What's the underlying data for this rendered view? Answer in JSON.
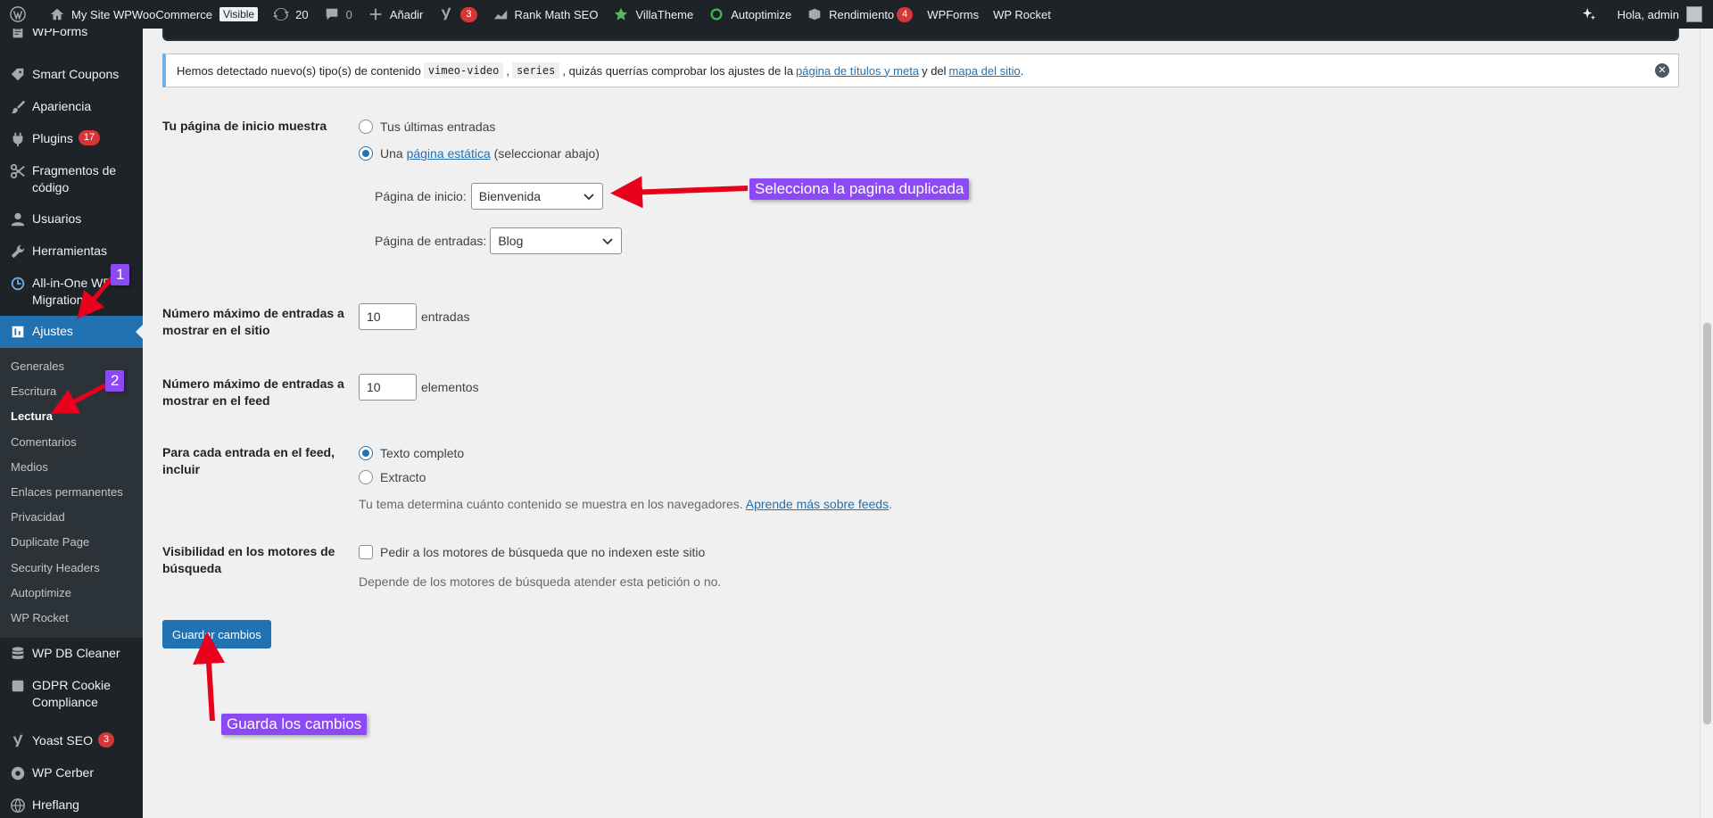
{
  "adminbar": {
    "site_name": "My Site WPWooCommerce",
    "visible_badge": "Visible",
    "updates_count": "20",
    "comments_count": "0",
    "add_new": "Añadir",
    "yoast_count": "3",
    "rank_math": "Rank Math SEO",
    "villatheme": "VillaTheme",
    "autoptimize": "Autoptimize",
    "rendimiento": "Rendimiento",
    "rendimiento_count": "4",
    "wpforms": "WPForms",
    "wprocket": "WP Rocket",
    "greeting": "Hola, admin"
  },
  "sidebar": {
    "items": [
      {
        "label": "WPForms",
        "icon": "wpforms-icon"
      },
      {
        "label": "Smart Coupons",
        "icon": "coupon-icon"
      },
      {
        "label": "Apariencia",
        "icon": "brush-icon"
      },
      {
        "label": "Plugins",
        "icon": "plugin-icon",
        "count": "17"
      },
      {
        "label": "Fragmentos de código",
        "icon": "scissors-icon"
      },
      {
        "label": "Usuarios",
        "icon": "user-icon"
      },
      {
        "label": "Herramientas",
        "icon": "wrench-icon"
      },
      {
        "label": "All-in-One WP Migration",
        "icon": "migration-icon"
      },
      {
        "label": "Ajustes",
        "icon": "settings-icon"
      }
    ],
    "submenu": [
      "Generales",
      "Escritura",
      "Lectura",
      "Comentarios",
      "Medios",
      "Enlaces permanentes",
      "Privacidad",
      "Duplicate Page",
      "Security Headers",
      "Autoptimize",
      "WP Rocket"
    ],
    "items_after": [
      {
        "label": "WP DB Cleaner",
        "icon": "database-icon"
      },
      {
        "label": "GDPR Cookie Compliance",
        "icon": "cookie-icon"
      },
      {
        "label": "Yoast SEO",
        "icon": "yoast-icon",
        "count": "3"
      },
      {
        "label": "WP Cerber",
        "icon": "shield-icon"
      },
      {
        "label": "Hreflang",
        "icon": "globe-icon"
      }
    ]
  },
  "notice": {
    "text_1": "Hemos detectado nuevo(s) tipo(s) de contenido",
    "code_1": "vimeo-video",
    "sep": ",",
    "code_2": "series",
    "text_2": ", quizás querrías comprobar los ajustes de la",
    "link_1": "página de títulos y meta",
    "text_3": "y del",
    "link_2": "mapa del sitio",
    "text_4": "."
  },
  "form": {
    "front_page": {
      "label": "Tu página de inicio muestra",
      "option_latest": "Tus últimas entradas",
      "option_static_prefix": "Una",
      "option_static_link": "página estática",
      "option_static_suffix": "(seleccionar abajo)",
      "home_label": "Página de inicio:",
      "home_value": "Bienvenida",
      "posts_label": "Página de entradas:",
      "posts_value": "Blog"
    },
    "posts_per_page": {
      "label": "Número máximo de entradas a mostrar en el sitio",
      "value": "10",
      "unit": "entradas"
    },
    "posts_per_rss": {
      "label": "Número máximo de entradas a mostrar en el feed",
      "value": "10",
      "unit": "elementos"
    },
    "rss_use_excerpt": {
      "label": "Para cada entrada en el feed, incluir",
      "option_full": "Texto completo",
      "option_excerpt": "Extracto",
      "desc_prefix": "Tu tema determina cuánto contenido se muestra en los navegadores.",
      "desc_link": "Aprende más sobre feeds",
      "desc_suffix": "."
    },
    "blog_public": {
      "label": "Visibilidad en los motores de búsqueda",
      "checkbox_label": "Pedir a los motores de búsqueda que no indexen este sitio",
      "desc": "Depende de los motores de búsqueda atender esta petición o no."
    },
    "submit": "Guardar cambios"
  },
  "annotations": {
    "a1": "1",
    "a2": "2",
    "select_dup": "Selecciona la pagina duplicada",
    "save": "Guarda los cambios",
    "color": "#8c4af7",
    "arrow_color": "#e8001c"
  }
}
